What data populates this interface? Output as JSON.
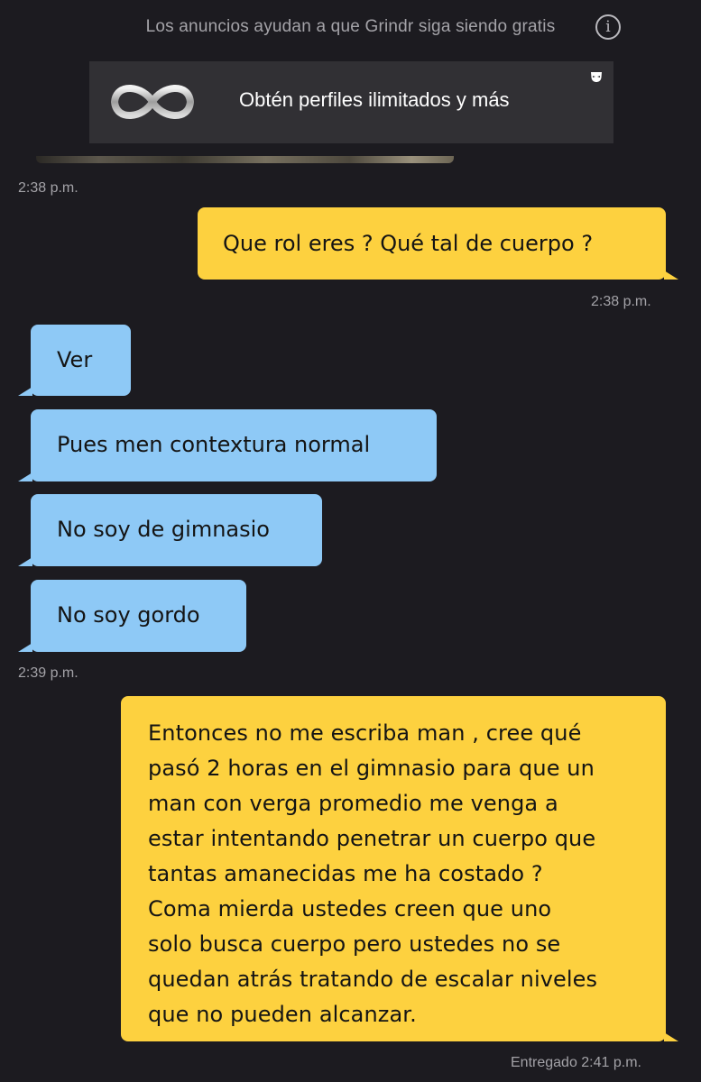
{
  "ad": {
    "notice": "Los anuncios ayudan a que Grindr siga siendo gratis",
    "banner_text": "Obtén perfiles ilimitados y más",
    "info_glyph": "i"
  },
  "icons": [
    "info-icon",
    "infinity-icon",
    "grindr-mask-icon"
  ],
  "colors": {
    "background": "#1c1b20",
    "sent_bubble": "#fdd13f",
    "received_bubble": "#8ec9f6",
    "banner": "#313034"
  },
  "messages": [
    {
      "time": "2:38 p.m."
    },
    {
      "direction": "sent",
      "text": "Que rol eres ?  Qué tal de cuerpo ?",
      "time": "2:38 p.m."
    },
    {
      "direction": "received",
      "text": "Ver"
    },
    {
      "direction": "received",
      "text": "Pues men contextura normal"
    },
    {
      "direction": "received",
      "text": "No soy de gimnasio"
    },
    {
      "direction": "received",
      "text": "No soy gordo",
      "time": "2:39 p.m."
    },
    {
      "direction": "sent",
      "text": "Entonces no me escriba man , cree qué\npasó 2 horas en el gimnasio para que un\nman con verga promedio me venga a\nestar intentando penetrar un cuerpo que\ntantas amanecidas me ha costado ?\nComa mierda ustedes  creen que uno\nsolo busca cuerpo pero ustedes no se\nquedan atrás tratando de escalar niveles\nque no pueden alcanzar.",
      "time": "Entregado 2:41 p.m."
    }
  ]
}
